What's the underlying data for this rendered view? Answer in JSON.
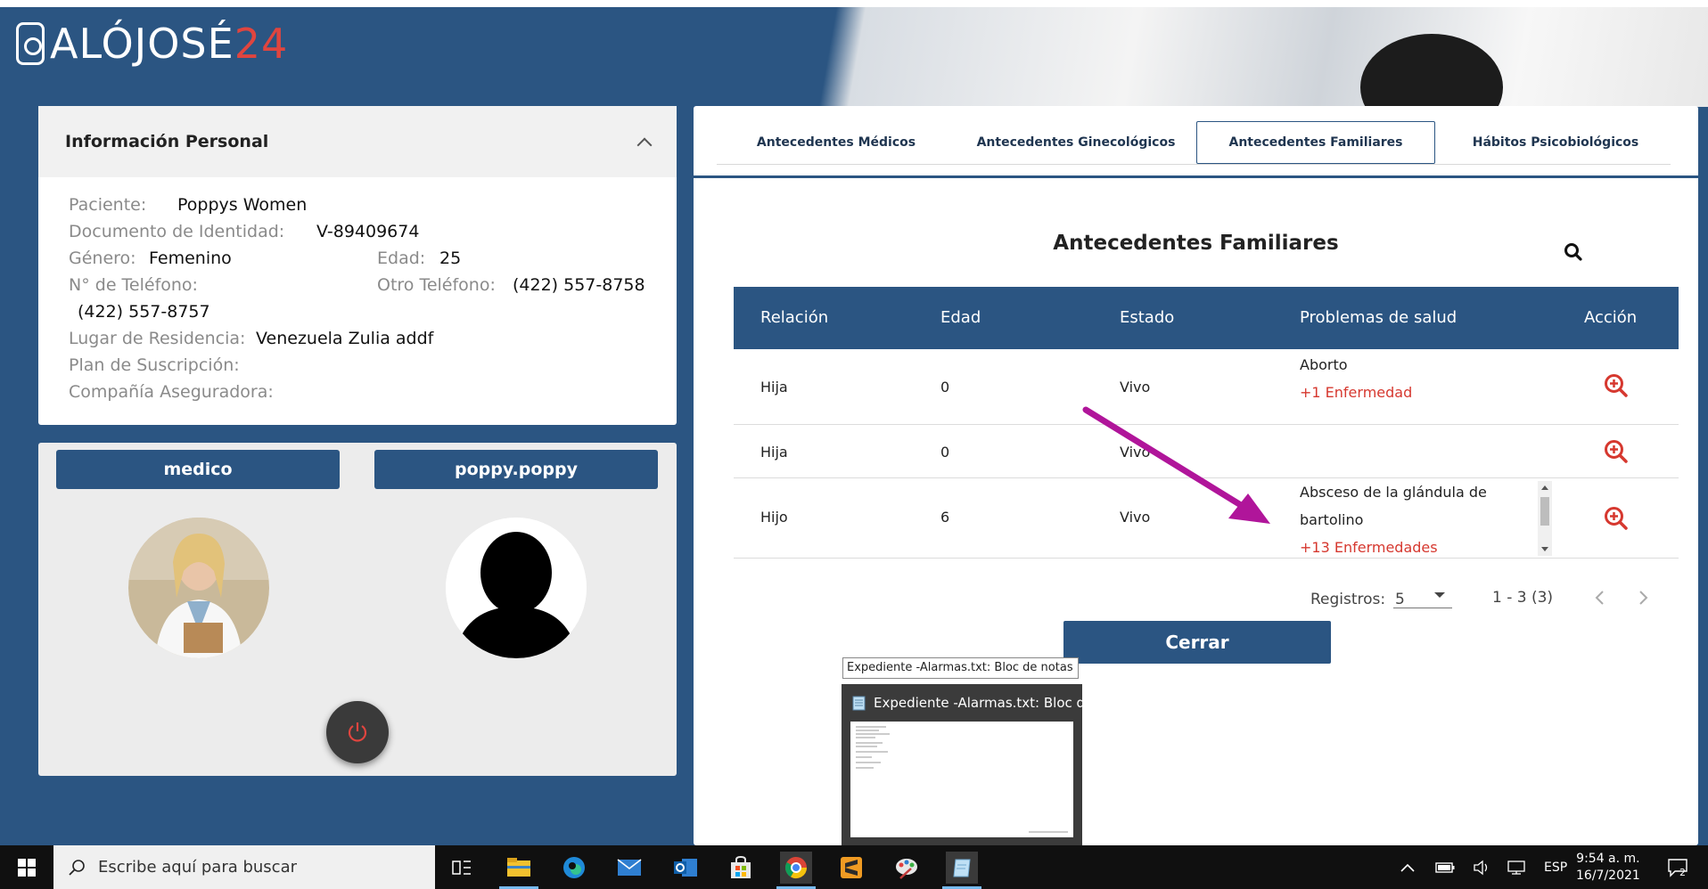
{
  "app": {
    "logo_text": "ALÓJOSÉ",
    "logo_num": "24"
  },
  "personal": {
    "title": "Información Personal",
    "paciente_label": "Paciente:",
    "paciente": "Poppys Women",
    "documento_label": "Documento de Identidad:",
    "documento": "V-89409674",
    "genero_label": "Género:",
    "genero": "Femenino",
    "edad_label": "Edad:",
    "edad": "25",
    "telefono_label": "N° de Teléfono:",
    "telefono": "(422) 557-8757",
    "otro_tel_label": "Otro Teléfono:",
    "otro_tel": "(422) 557-8758",
    "residencia_label": "Lugar de Residencia:",
    "residencia": "Venezuela Zulia addf",
    "plan_label": "Plan de Suscripción:",
    "aseguradora_label": "Compañía Aseguradora:"
  },
  "users": {
    "doctor": "medico",
    "patient": "poppy.poppy"
  },
  "tabs": [
    {
      "label": "Antecedentes Médicos"
    },
    {
      "label": "Antecedentes Ginecológicos"
    },
    {
      "label": "Antecedentes Familiares"
    },
    {
      "label": "Hábitos Psicobiológicos"
    }
  ],
  "section_title": "Antecedentes Familiares",
  "table": {
    "headers": [
      "Relación",
      "Edad",
      "Estado",
      "Problemas de salud",
      "Acción"
    ],
    "rows": [
      {
        "relacion": "Hija",
        "edad": "0",
        "estado": "Vivo",
        "problema": "Aborto",
        "extra": "+1 Enfermedad"
      },
      {
        "relacion": "Hija",
        "edad": "0",
        "estado": "Vivo",
        "problema": "",
        "extra": ""
      },
      {
        "relacion": "Hijo",
        "edad": "6",
        "estado": "Vivo",
        "problema": "Absceso de la glándula de",
        "problema2": "bartolino",
        "extra": "+13 Enfermedades"
      }
    ]
  },
  "pager": {
    "label": "Registros:",
    "value": "5",
    "range": "1 - 3 (3)"
  },
  "close_button": "Cerrar",
  "tooltip": "Expediente -Alarmas.txt: Bloc de notas",
  "thumb_title": "Expediente -Alarmas.txt: Bloc d...",
  "taskbar": {
    "search_placeholder": "Escribe aquí para buscar",
    "lang": "ESP",
    "time": "9:54 a. m.",
    "date": "16/7/2021",
    "notif_count": "2"
  },
  "colors": {
    "primary": "#2b5582",
    "accent": "#e0453f",
    "annotation": "#b0159a"
  }
}
